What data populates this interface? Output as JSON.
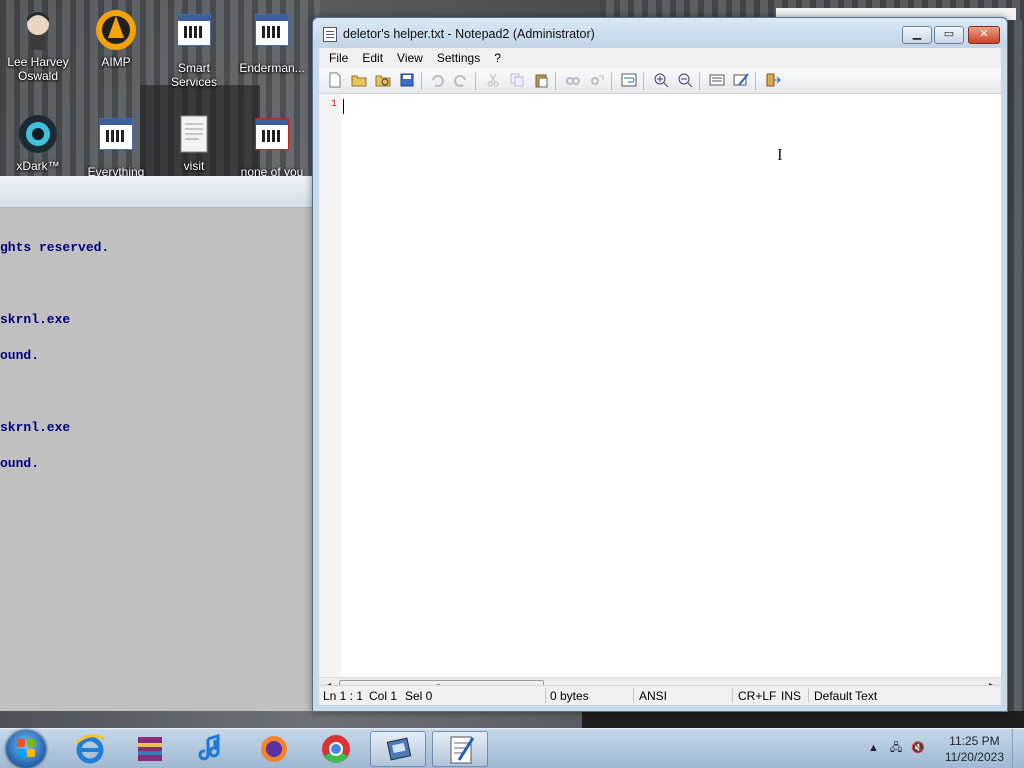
{
  "desktop": {
    "icons": [
      {
        "label": "Lee Harvey\nOswald"
      },
      {
        "label": "AIMP"
      },
      {
        "label": "Smart\nServices"
      },
      {
        "label": "Enderman..."
      },
      {
        "label": "xDark™"
      },
      {
        "label": "Everything"
      },
      {
        "label": "visit"
      },
      {
        "label": "none of you"
      }
    ]
  },
  "console": {
    "lines": [
      "ghts reserved.",
      "",
      "skrnl.exe",
      "ound.",
      "",
      "skrnl.exe",
      "ound."
    ]
  },
  "window": {
    "title": "deletor's helper.txt - Notepad2 (Administrator)",
    "minimize_label": "▁",
    "maximize_label": "▭",
    "close_label": "✕"
  },
  "menu": {
    "items": [
      "File",
      "Edit",
      "View",
      "Settings",
      "?"
    ]
  },
  "editor": {
    "line_number": "1",
    "content": ""
  },
  "statusbar": {
    "position": "Ln 1 : 1",
    "column": "Col 1",
    "selection": "Sel 0",
    "size": "0 bytes",
    "encoding": "ANSI",
    "line_endings": "CR+LF",
    "mode": "INS",
    "scheme": "Default Text"
  },
  "taskbar": {
    "time": "11:25 PM",
    "date": "11/20/2023"
  },
  "colors": {
    "line_number": "#c02020",
    "console_text": "#000080",
    "close_button": "#c84326"
  }
}
